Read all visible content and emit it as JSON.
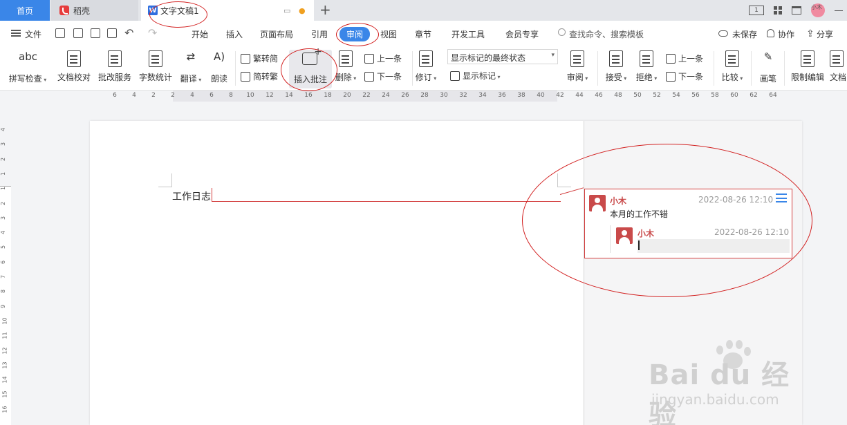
{
  "tabs": {
    "home": "首页",
    "daoke": "稻壳",
    "doc": "文字文稿1"
  },
  "menubar": {
    "file": "文件",
    "items": [
      "开始",
      "插入",
      "页面布局",
      "引用",
      "审阅",
      "视图",
      "章节",
      "开发工具",
      "会员专享"
    ],
    "active": "审阅",
    "search": "查找命令、搜索模板",
    "unsaved": "未保存",
    "collab": "协作",
    "share": "分享"
  },
  "topbar": {
    "layout_box": "1",
    "user": "小木"
  },
  "ribbon": {
    "spell": "拼写检查",
    "proof": "文档校对",
    "review_service": "批改服务",
    "wordcount": "字数统计",
    "translate": "翻译",
    "read": "朗读",
    "s2t": "繁转简",
    "t2s": "简转繁",
    "insert_comment": "插入批注",
    "delete": "删除",
    "prev": "上一条",
    "next": "下一条",
    "revise": "修订",
    "markup_select": "显示标记的最终状态",
    "show_markup": "显示标记",
    "review": "审阅",
    "accept": "接受",
    "reject": "拒绝",
    "prev2": "上一条",
    "next2": "下一条",
    "compare": "比较",
    "pen": "画笔",
    "restrict": "限制编辑",
    "doc_more": "文档"
  },
  "ruler": {
    "h_ticks": [
      "6",
      "4",
      "2",
      "2",
      "4",
      "6",
      "8",
      "10",
      "12",
      "14",
      "16",
      "18",
      "20",
      "22",
      "24",
      "26",
      "28",
      "30",
      "32",
      "34",
      "36",
      "38",
      "40",
      "42",
      "44",
      "46",
      "48",
      "50",
      "52",
      "54",
      "56",
      "58",
      "60",
      "62",
      "64"
    ],
    "v_ticks": [
      "4",
      "3",
      "2",
      "1",
      "1",
      "2",
      "3",
      "4",
      "5",
      "6",
      "7",
      "8",
      "9",
      "10",
      "11",
      "12",
      "13",
      "14",
      "15",
      "16"
    ]
  },
  "document": {
    "text": "工作日志"
  },
  "comment": {
    "author": "小木",
    "time": "2022-08-26 12:10",
    "body": "本月的工作不错",
    "reply_author": "小木",
    "reply_time": "2022-08-26 12:10"
  },
  "watermark": {
    "brand": "Bai du 经验",
    "url": "jingyan.baidu.com"
  },
  "colors": {
    "accent": "#3a86e8",
    "comment_red": "#c94a4a",
    "annotation_red": "#d21f1f"
  }
}
